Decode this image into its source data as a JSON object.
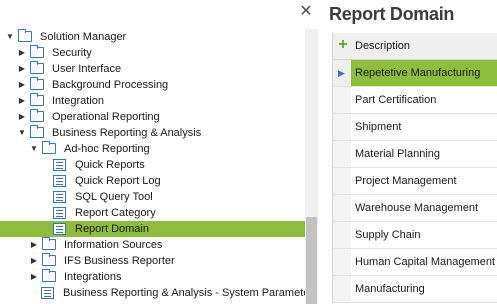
{
  "nav": {
    "close_glyph": "✕",
    "tree": [
      {
        "label": "Solution Manager",
        "level": 0,
        "expander": "expanded",
        "icon": "folder-icon",
        "selected": false
      },
      {
        "label": "Security",
        "level": 1,
        "expander": "collapsed",
        "icon": "folder-icon",
        "selected": false
      },
      {
        "label": "User Interface",
        "level": 1,
        "expander": "collapsed",
        "icon": "folder-icon",
        "selected": false
      },
      {
        "label": "Background Processing",
        "level": 1,
        "expander": "collapsed",
        "icon": "folder-icon",
        "selected": false
      },
      {
        "label": "Integration",
        "level": 1,
        "expander": "collapsed",
        "icon": "folder-icon",
        "selected": false
      },
      {
        "label": "Operational Reporting",
        "level": 1,
        "expander": "collapsed",
        "icon": "folder-icon",
        "selected": false
      },
      {
        "label": "Business Reporting & Analysis",
        "level": 1,
        "expander": "expanded",
        "icon": "folder-icon",
        "selected": false
      },
      {
        "label": "Ad-hoc Reporting",
        "level": 2,
        "expander": "expanded",
        "icon": "folder-icon",
        "selected": false
      },
      {
        "label": "Quick Reports",
        "level": 3,
        "expander": "none",
        "icon": "page-icon",
        "selected": false
      },
      {
        "label": "Quick Report Log",
        "level": 3,
        "expander": "none",
        "icon": "page-icon",
        "selected": false
      },
      {
        "label": "SQL Query Tool",
        "level": 3,
        "expander": "none",
        "icon": "page-icon",
        "selected": false
      },
      {
        "label": "Report Category",
        "level": 3,
        "expander": "none",
        "icon": "page-icon",
        "selected": false
      },
      {
        "label": "Report Domain",
        "level": 3,
        "expander": "none",
        "icon": "page-icon",
        "selected": true
      },
      {
        "label": "Information Sources",
        "level": 2,
        "expander": "collapsed",
        "icon": "folder-icon",
        "selected": false
      },
      {
        "label": "IFS Business Reporter",
        "level": 2,
        "expander": "collapsed",
        "icon": "folder-icon",
        "selected": false
      },
      {
        "label": "Integrations",
        "level": 2,
        "expander": "collapsed",
        "icon": "folder-icon",
        "selected": false
      },
      {
        "label": "Business Reporting & Analysis - System Paramete",
        "level": 2,
        "expander": "none",
        "icon": "page-icon",
        "selected": false
      }
    ]
  },
  "detail": {
    "title": "Report Domain",
    "header_plus": "+",
    "column_header": "Description",
    "rows": [
      {
        "label": "Repetetive Manufacturing",
        "selected": true
      },
      {
        "label": "Part Certification",
        "selected": false
      },
      {
        "label": "Shipment",
        "selected": false
      },
      {
        "label": "Material Planning",
        "selected": false
      },
      {
        "label": "Project Management",
        "selected": false
      },
      {
        "label": "Warehouse Management",
        "selected": false
      },
      {
        "label": "Supply Chain",
        "selected": false
      },
      {
        "label": "Human Capital Management",
        "selected": false
      },
      {
        "label": "Manufacturing",
        "selected": false
      }
    ]
  },
  "colors": {
    "selection": "#8dbd3a",
    "icon_blue": "#3b73b9",
    "plus_green": "#6aa12d"
  }
}
